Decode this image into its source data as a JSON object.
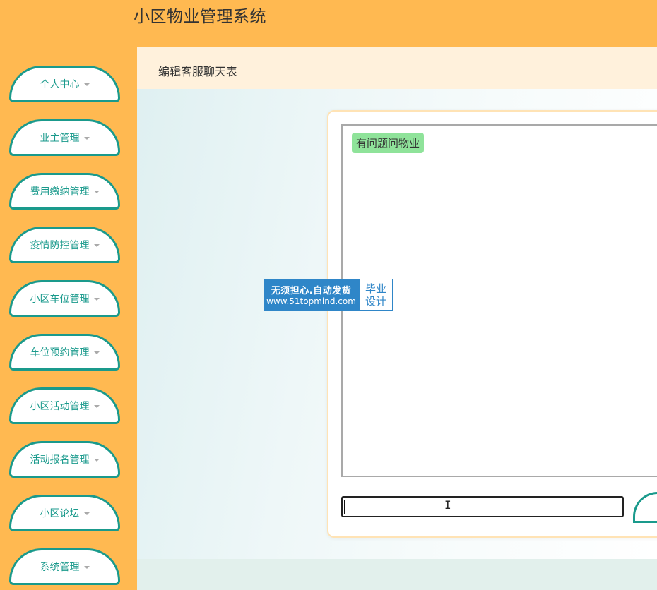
{
  "app": {
    "title": "小区物业管理系统"
  },
  "sidebar": {
    "items": [
      {
        "label": "个人中心"
      },
      {
        "label": "业主管理"
      },
      {
        "label": "费用缴纳管理"
      },
      {
        "label": "疫情防控管理"
      },
      {
        "label": "小区车位管理"
      },
      {
        "label": "车位预约管理"
      },
      {
        "label": "小区活动管理"
      },
      {
        "label": "活动报名管理"
      },
      {
        "label": "小区论坛"
      },
      {
        "label": "系统管理"
      }
    ]
  },
  "breadcrumb": {
    "current": "编辑客服聊天表"
  },
  "chat": {
    "messages": [
      {
        "text": "有问题问物业",
        "color": "#8fe39a"
      }
    ],
    "input": {
      "value": "",
      "placeholder": ""
    }
  },
  "watermark": {
    "line1": "无须担心.自动发货",
    "line2": "www.51topmind.com",
    "badge_line1": "毕业",
    "badge_line2": "设计"
  },
  "colors": {
    "accent": "#ffb951",
    "nav_border": "#1a9a8c",
    "breadcrumb_bg": "#fff1dc",
    "bubble": "#8fe39a"
  }
}
